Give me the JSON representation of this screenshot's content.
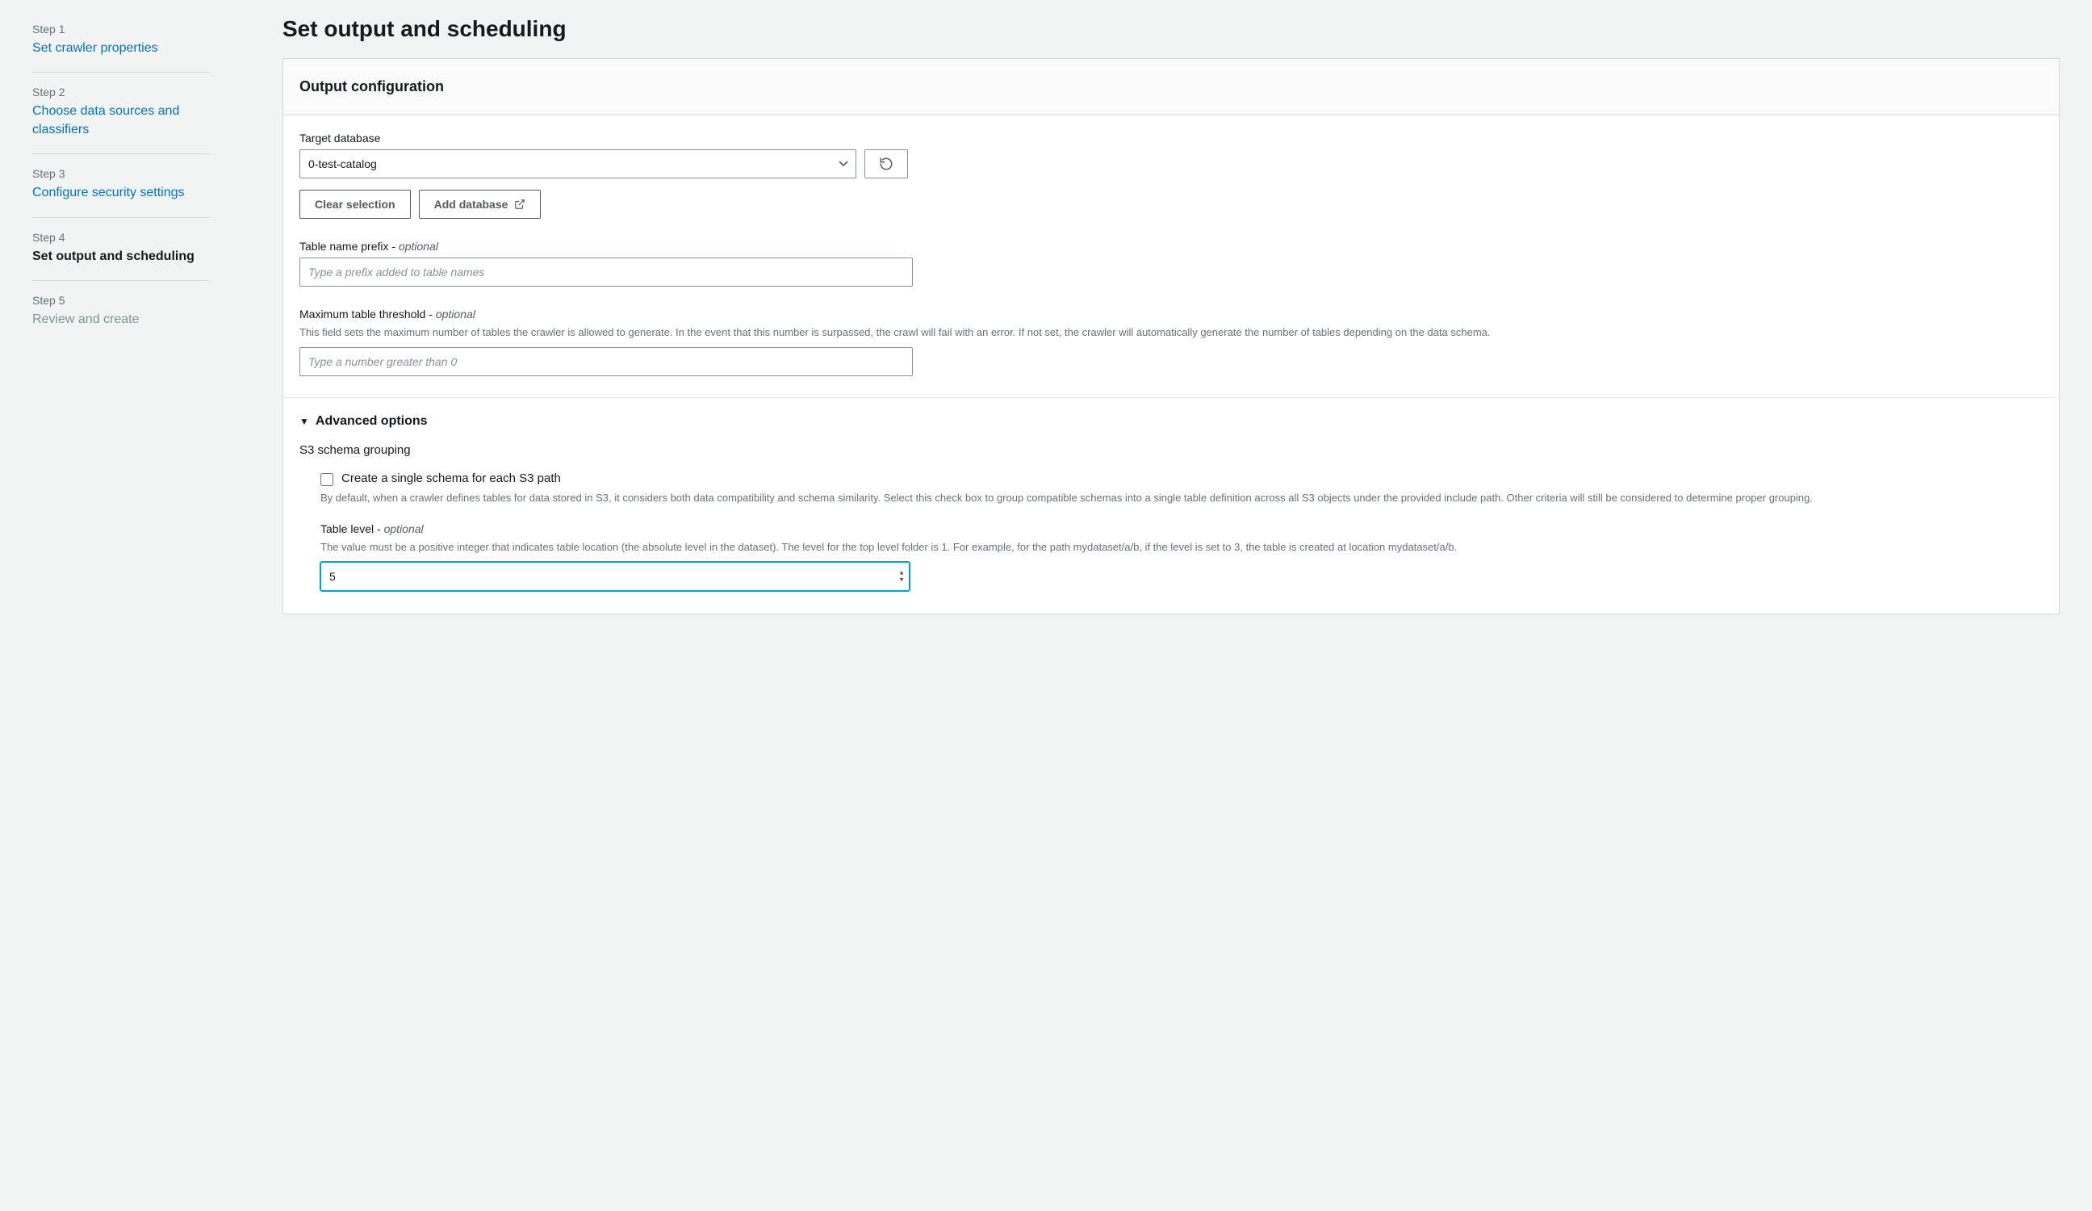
{
  "sidebar": {
    "steps": [
      {
        "num": "Step 1",
        "title": "Set crawler properties",
        "state": "link"
      },
      {
        "num": "Step 2",
        "title": "Choose data sources and classifiers",
        "state": "link"
      },
      {
        "num": "Step 3",
        "title": "Configure security settings",
        "state": "link"
      },
      {
        "num": "Step 4",
        "title": "Set output and scheduling",
        "state": "active"
      },
      {
        "num": "Step 5",
        "title": "Review and create",
        "state": "disabled"
      }
    ]
  },
  "main": {
    "pageTitle": "Set output and scheduling",
    "outputConfig": {
      "heading": "Output configuration",
      "targetDatabase": {
        "label": "Target database",
        "value": "0-test-catalog"
      },
      "clearSelectionLabel": "Clear selection",
      "addDatabaseLabel": "Add database",
      "tablePrefix": {
        "label": "Table name prefix - ",
        "optional": "optional",
        "placeholder": "Type a prefix added to table names",
        "value": ""
      },
      "maxThreshold": {
        "label": "Maximum table threshold - ",
        "optional": "optional",
        "help": "This field sets the maximum number of tables the crawler is allowed to generate. In the event that this number is surpassed, the crawl will fail with an error. If not set, the crawler will automatically generate the number of tables depending on the data schema.",
        "placeholder": "Type a number greater than 0",
        "value": ""
      },
      "advanced": {
        "heading": "Advanced options",
        "s3grouping": {
          "heading": "S3 schema grouping",
          "checkboxLabel": "Create a single schema for each S3 path",
          "checkboxHelp": "By default, when a crawler defines tables for data stored in S3, it considers both data compatibility and schema similarity. Select this check box to group compatible schemas into a single table definition across all S3 objects under the provided include path. Other criteria will still be considered to determine proper grouping.",
          "checked": false
        },
        "tableLevel": {
          "label": "Table level - ",
          "optional": "optional",
          "help": "The value must be a positive integer that indicates table location (the absolute level in the dataset). The level for the top level folder is 1. For example, for the path mydataset/a/b, if the level is set to 3, the table is created at location mydataset/a/b.",
          "value": "5"
        }
      }
    }
  }
}
